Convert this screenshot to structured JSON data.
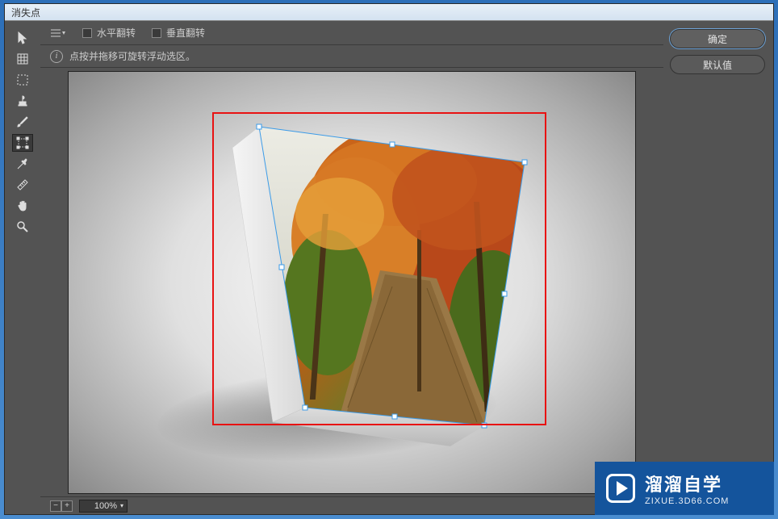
{
  "window": {
    "title": "消失点"
  },
  "options": {
    "flip_h": "水平翻转",
    "flip_v": "垂直翻转"
  },
  "info": {
    "text": "点按并拖移可旋转浮动选区。"
  },
  "buttons": {
    "ok": "确定",
    "default": "默认值"
  },
  "status": {
    "zoom": "100%"
  },
  "tools": [
    {
      "name": "arrow-tool",
      "icon": "arrow"
    },
    {
      "name": "create-plane-tool",
      "icon": "grid"
    },
    {
      "name": "marquee-tool",
      "icon": "marquee"
    },
    {
      "name": "stamp-tool",
      "icon": "stamp"
    },
    {
      "name": "brush-tool",
      "icon": "brush"
    },
    {
      "name": "transform-tool",
      "icon": "transform",
      "selected": true
    },
    {
      "name": "eyedropper-tool",
      "icon": "eyedropper"
    },
    {
      "name": "measure-tool",
      "icon": "ruler"
    },
    {
      "name": "hand-tool",
      "icon": "hand"
    },
    {
      "name": "zoom-tool",
      "icon": "zoom"
    }
  ],
  "watermark": {
    "title": "溜溜自学",
    "sub": "ZIXUE.3D66.COM"
  }
}
